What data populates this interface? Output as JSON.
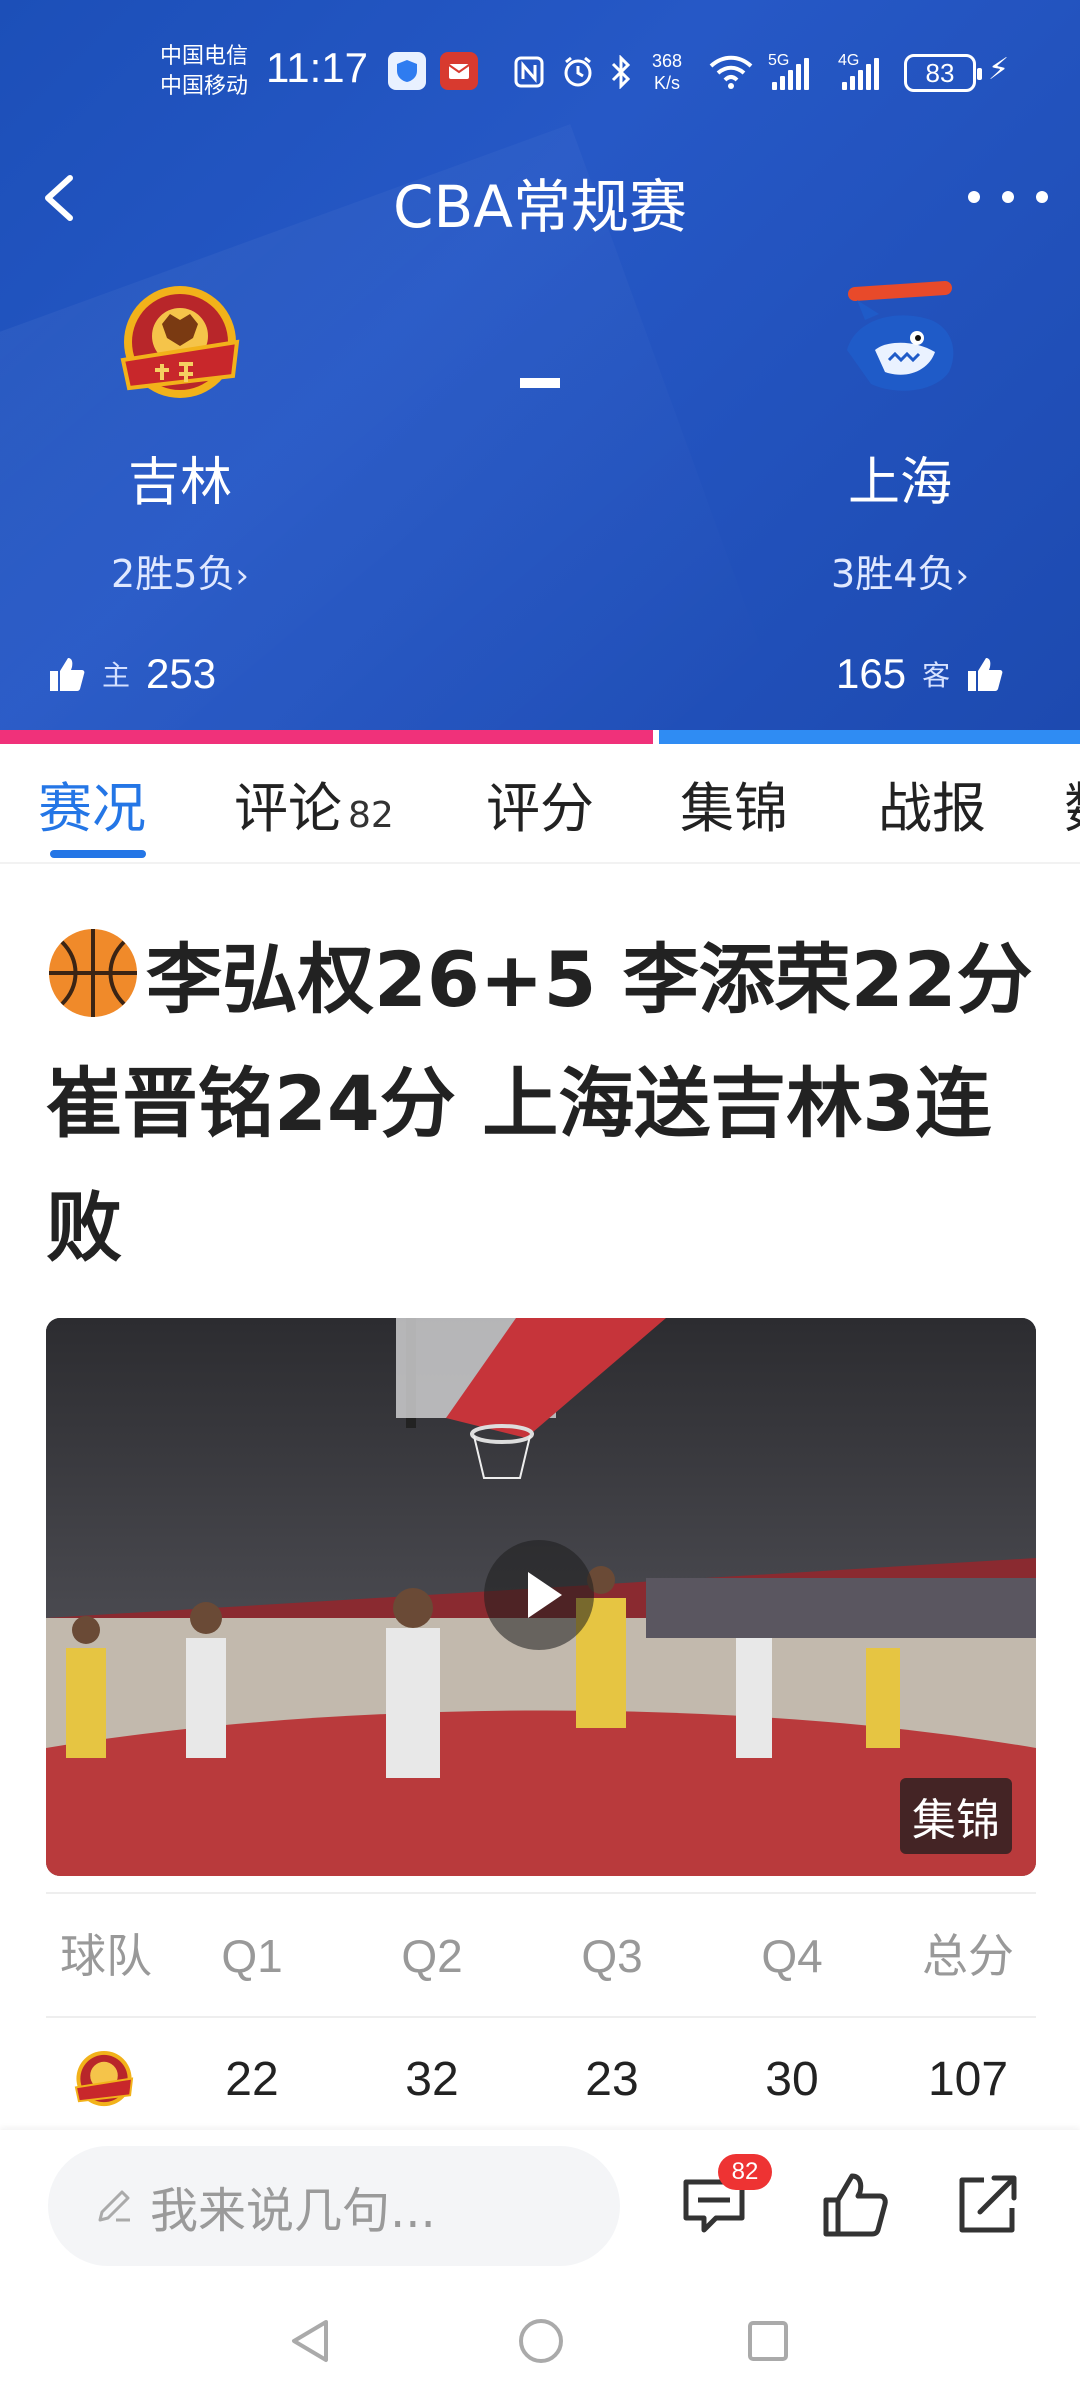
{
  "status_bar": {
    "carrier_1": "中国电信",
    "carrier_2": "中国移动",
    "time": "11:17",
    "speed_value": "368",
    "speed_unit": "K/s",
    "net_1": "5G",
    "net_2": "4G",
    "battery": "83"
  },
  "nav": {
    "title": "CBA常规赛"
  },
  "match": {
    "home": {
      "name": "吉林",
      "record": "2胜5负",
      "like_label": "主",
      "likes": "253"
    },
    "away": {
      "name": "上海",
      "record": "3胜4负",
      "like_label": "客",
      "likes": "165"
    },
    "score_separator": "-",
    "home_vote_fraction": 0.605
  },
  "tabs": [
    {
      "label": "赛况",
      "active": true
    },
    {
      "label": "评论",
      "count": "82"
    },
    {
      "label": "评分"
    },
    {
      "label": "集锦"
    },
    {
      "label": "战报"
    },
    {
      "label": "数"
    }
  ],
  "article": {
    "headline": "李弘权26+5 李添荣22分 崔晋铭24分 上海送吉林3连败",
    "video_tag": "集锦"
  },
  "score_table": {
    "headers": [
      "球队",
      "Q1",
      "Q2",
      "Q3",
      "Q4",
      "总分"
    ],
    "rows": [
      {
        "team": "吉林",
        "q1": "22",
        "q2": "32",
        "q3": "23",
        "q4": "30",
        "total": "107"
      }
    ]
  },
  "bottom_bar": {
    "comment_placeholder": "我来说几句...",
    "comment_count": "82"
  },
  "colors": {
    "header_blue": "#2256c0",
    "home_bar": "#f0317a",
    "away_bar": "#2f8cf3",
    "accent": "#2476e6"
  }
}
